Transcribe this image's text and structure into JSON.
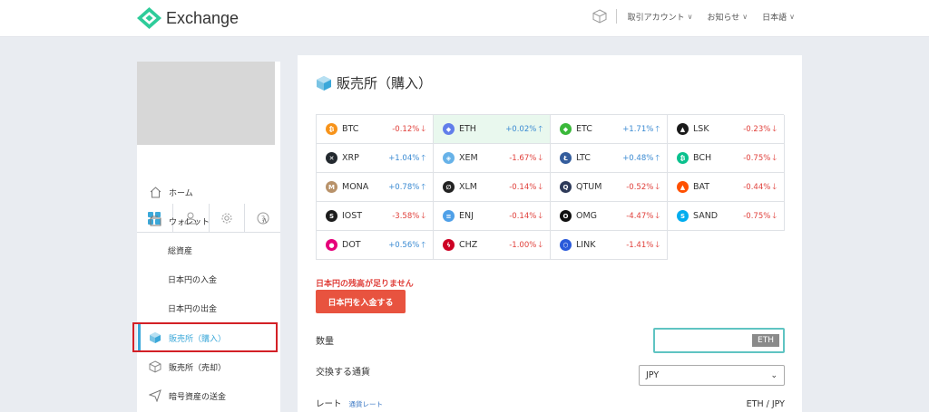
{
  "header": {
    "app_name": "Exchange",
    "menus": [
      {
        "label": "取引アカウント"
      },
      {
        "label": "お知らせ"
      },
      {
        "label": "日本語"
      }
    ],
    "brand_color": "#2ecc9a"
  },
  "sidebar": {
    "items": [
      {
        "label": "ホーム"
      },
      {
        "label": "ウォレット"
      },
      {
        "label": "総資産"
      },
      {
        "label": "日本円の入金"
      },
      {
        "label": "日本円の出金"
      },
      {
        "label": "販売所（購入）"
      },
      {
        "label": "販売所（売却）"
      },
      {
        "label": "暗号資産の送金"
      }
    ],
    "active_color": "#3ba8d9"
  },
  "main": {
    "title": "販売所（購入）",
    "coins": [
      {
        "symbol": "BTC",
        "change": "-0.12%",
        "dir": "down",
        "icon_color": "#f7931a",
        "glyph": "₿"
      },
      {
        "symbol": "ETH",
        "change": "+0.02%",
        "dir": "up",
        "icon_color": "#627eea",
        "glyph": "◆",
        "highlight": true
      },
      {
        "symbol": "ETC",
        "change": "+1.71%",
        "dir": "up",
        "icon_color": "#3ab83a",
        "glyph": "◆"
      },
      {
        "symbol": "LSK",
        "change": "-0.23%",
        "dir": "down",
        "icon_color": "#1a1a1a",
        "glyph": "▲"
      },
      {
        "symbol": "XRP",
        "change": "+1.04%",
        "dir": "up",
        "icon_color": "#23292f",
        "glyph": "✕"
      },
      {
        "symbol": "XEM",
        "change": "-1.67%",
        "dir": "down",
        "icon_color": "#67b2e8",
        "glyph": "◈"
      },
      {
        "symbol": "LTC",
        "change": "+0.48%",
        "dir": "up",
        "icon_color": "#345d9d",
        "glyph": "Ł"
      },
      {
        "symbol": "BCH",
        "change": "-0.75%",
        "dir": "down",
        "icon_color": "#0ac18e",
        "glyph": "₿"
      },
      {
        "symbol": "MONA",
        "change": "+0.78%",
        "dir": "up",
        "icon_color": "#b8926a",
        "glyph": "M"
      },
      {
        "symbol": "XLM",
        "change": "-0.14%",
        "dir": "down",
        "icon_color": "#222",
        "glyph": "∅"
      },
      {
        "symbol": "QTUM",
        "change": "-0.52%",
        "dir": "down",
        "icon_color": "#2e3a59",
        "glyph": "Q"
      },
      {
        "symbol": "BAT",
        "change": "-0.44%",
        "dir": "down",
        "icon_color": "#ff5000",
        "glyph": "▲"
      },
      {
        "symbol": "IOST",
        "change": "-3.58%",
        "dir": "down",
        "icon_color": "#1c1c1c",
        "glyph": "S"
      },
      {
        "symbol": "ENJ",
        "change": "-0.14%",
        "dir": "down",
        "icon_color": "#4fa0e8",
        "glyph": "≡"
      },
      {
        "symbol": "OMG",
        "change": "-4.47%",
        "dir": "down",
        "icon_color": "#101010",
        "glyph": "O"
      },
      {
        "symbol": "SAND",
        "change": "-0.75%",
        "dir": "down",
        "icon_color": "#00adef",
        "glyph": "S"
      },
      {
        "symbol": "DOT",
        "change": "+0.56%",
        "dir": "up",
        "icon_color": "#e6007a",
        "glyph": "●"
      },
      {
        "symbol": "CHZ",
        "change": "-1.00%",
        "dir": "down",
        "icon_color": "#cd0124",
        "glyph": "ϟ"
      },
      {
        "symbol": "LINK",
        "change": "-1.41%",
        "dir": "down",
        "icon_color": "#2a5ada",
        "glyph": "⬡"
      }
    ],
    "up_color": "#3a8ad2",
    "down_color": "#e0403b",
    "warning": "日本円の残高が足りません",
    "deposit_button": "日本円を入金する",
    "quantity_label": "数量",
    "quantity_unit": "ETH",
    "currency_label": "交換する通貨",
    "currency_value": "JPY",
    "rate_label": "レート",
    "rate_link": "通貨レート",
    "pair": "ETH / JPY"
  }
}
